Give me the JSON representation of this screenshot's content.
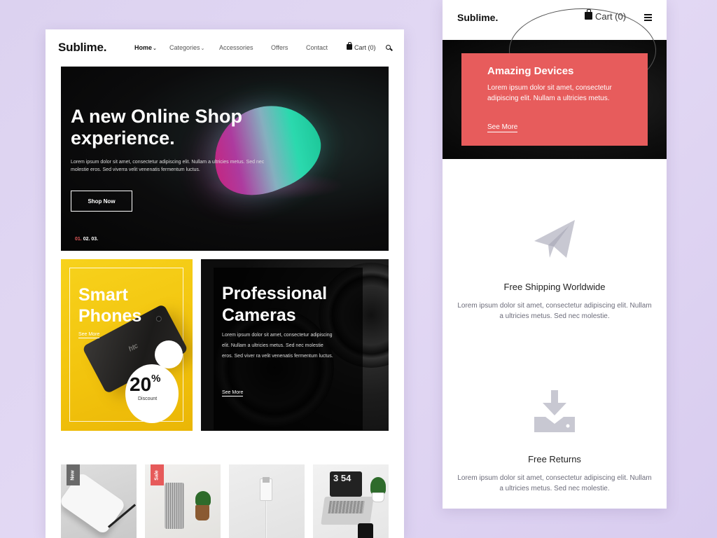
{
  "desktop": {
    "logo": "Sublime.",
    "nav": {
      "home": "Home",
      "categories": "Categories",
      "accessories": "Accessories",
      "offers": "Offers",
      "contact": "Contact",
      "cart": "Cart (0)"
    },
    "hero": {
      "title": "A new Online Shop experience.",
      "text": "Lorem ipsum dolor sit amet, consectetur adipiscing elit. Nullam a ultricies metus. Sed nec molestie eros. Sed viverra velit venenatis fermentum luctus.",
      "button": "Shop Now",
      "slides": [
        "01.",
        "02.",
        "03."
      ],
      "accent_color": "#e65a5a"
    },
    "promo_phones": {
      "title": "Smart Phones",
      "link": "See More",
      "phone_brand": "htc",
      "discount_value": "20",
      "discount_symbol": "%",
      "discount_label": "Discount",
      "color": "#f2c30d"
    },
    "promo_cameras": {
      "title": "Professional Cameras",
      "text": "Lorem ipsum dolor sit amet, consectetur adipiscing elit. Nullam a ultricies metus. Sed nec molestie eros. Sed viver ra velit venenatis fermentum luctus.",
      "link": "See More"
    },
    "products": [
      {
        "tag": "New"
      },
      {
        "tag": "Sale"
      },
      {
        "tag": ""
      },
      {
        "tag": "",
        "clock": "3 54"
      }
    ]
  },
  "mobile": {
    "logo": "Sublime.",
    "cart": "Cart (0)",
    "hero": {
      "title": "Amazing Devices",
      "text": "Lorem ipsum dolor sit amet, consectetur adipiscing elit. Nullam a ultricies metus.",
      "link": "See More",
      "color": "#e75c5c"
    },
    "features": [
      {
        "icon": "paper-plane-icon",
        "title": "Free Shipping Worldwide",
        "text": "Lorem ipsum dolor sit amet, consectetur adipiscing elit. Nullam a ultricies metus. Sed nec molestie."
      },
      {
        "icon": "download-tray-icon",
        "title": "Free Returns",
        "text": "Lorem ipsum dolor sit amet, consectetur adipiscing elit. Nullam a ultricies metus. Sed nec molestie."
      }
    ],
    "icon_color": "#c8c8d2"
  }
}
